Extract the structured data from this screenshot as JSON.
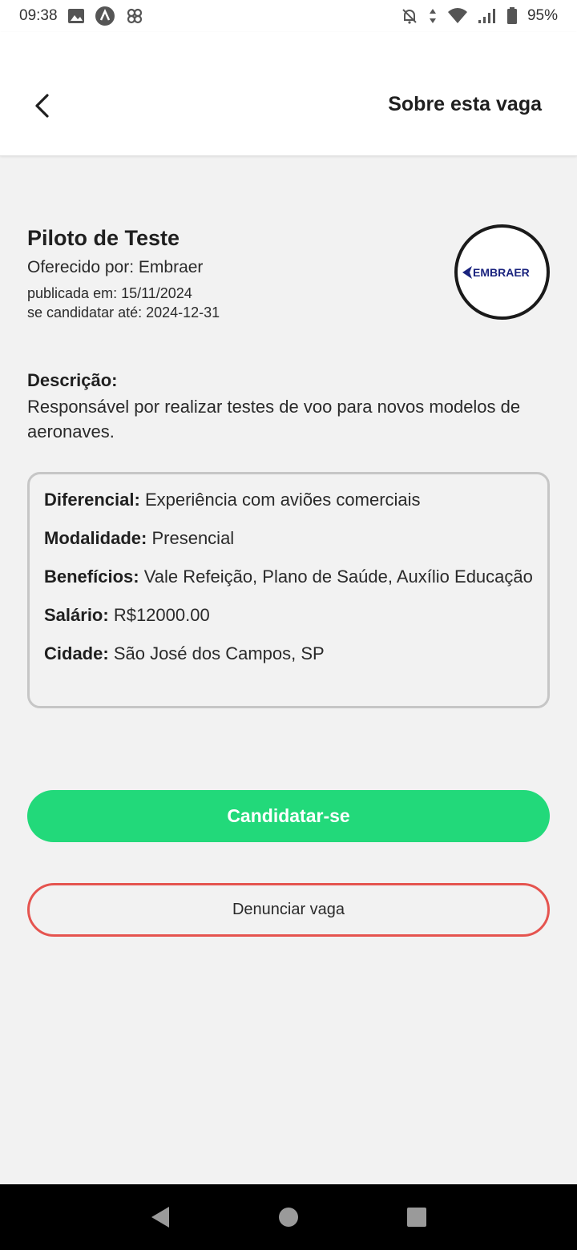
{
  "status_bar": {
    "time": "09:38",
    "battery": "95%",
    "left_icons": [
      "image-icon",
      "app-a-icon",
      "pinwheel-icon"
    ],
    "right_icons": [
      "bell-off-icon",
      "data-arrows-icon",
      "wifi-icon",
      "signal-icon",
      "battery-icon"
    ]
  },
  "header": {
    "back_icon": "chevron-left-icon",
    "title": "Sobre esta vaga"
  },
  "job": {
    "title": "Piloto de Teste",
    "company": "Oferecido por: Embraer",
    "published": "publicada em: 15/11/2024",
    "deadline": "se candidatar até: 2024-12-31",
    "logo_text": "EMBRAER",
    "logo_color": "#1a237e"
  },
  "description": {
    "label": "Descrição:",
    "text": "Responsável por realizar testes de voo para novos modelos de aeronaves."
  },
  "details": [
    {
      "label": "Diferencial:",
      "value": "Experiência com aviões comerciais"
    },
    {
      "label": "Modalidade:",
      "value": "Presencial"
    },
    {
      "label": "Benefícios:",
      "value": "Vale Refeição, Plano de Saúde, Auxílio Educação"
    },
    {
      "label": "Salário:",
      "value": "R$12000.00"
    },
    {
      "label": "Cidade:",
      "value": "São José dos Campos, SP"
    }
  ],
  "actions": {
    "apply_label": "Candidatar-se",
    "apply_color": "#22d97a",
    "report_label": "Denunciar vaga",
    "report_color": "#e5544f"
  },
  "nav": {
    "icons": [
      "back-triangle-icon",
      "home-circle-icon",
      "recents-square-icon"
    ]
  }
}
